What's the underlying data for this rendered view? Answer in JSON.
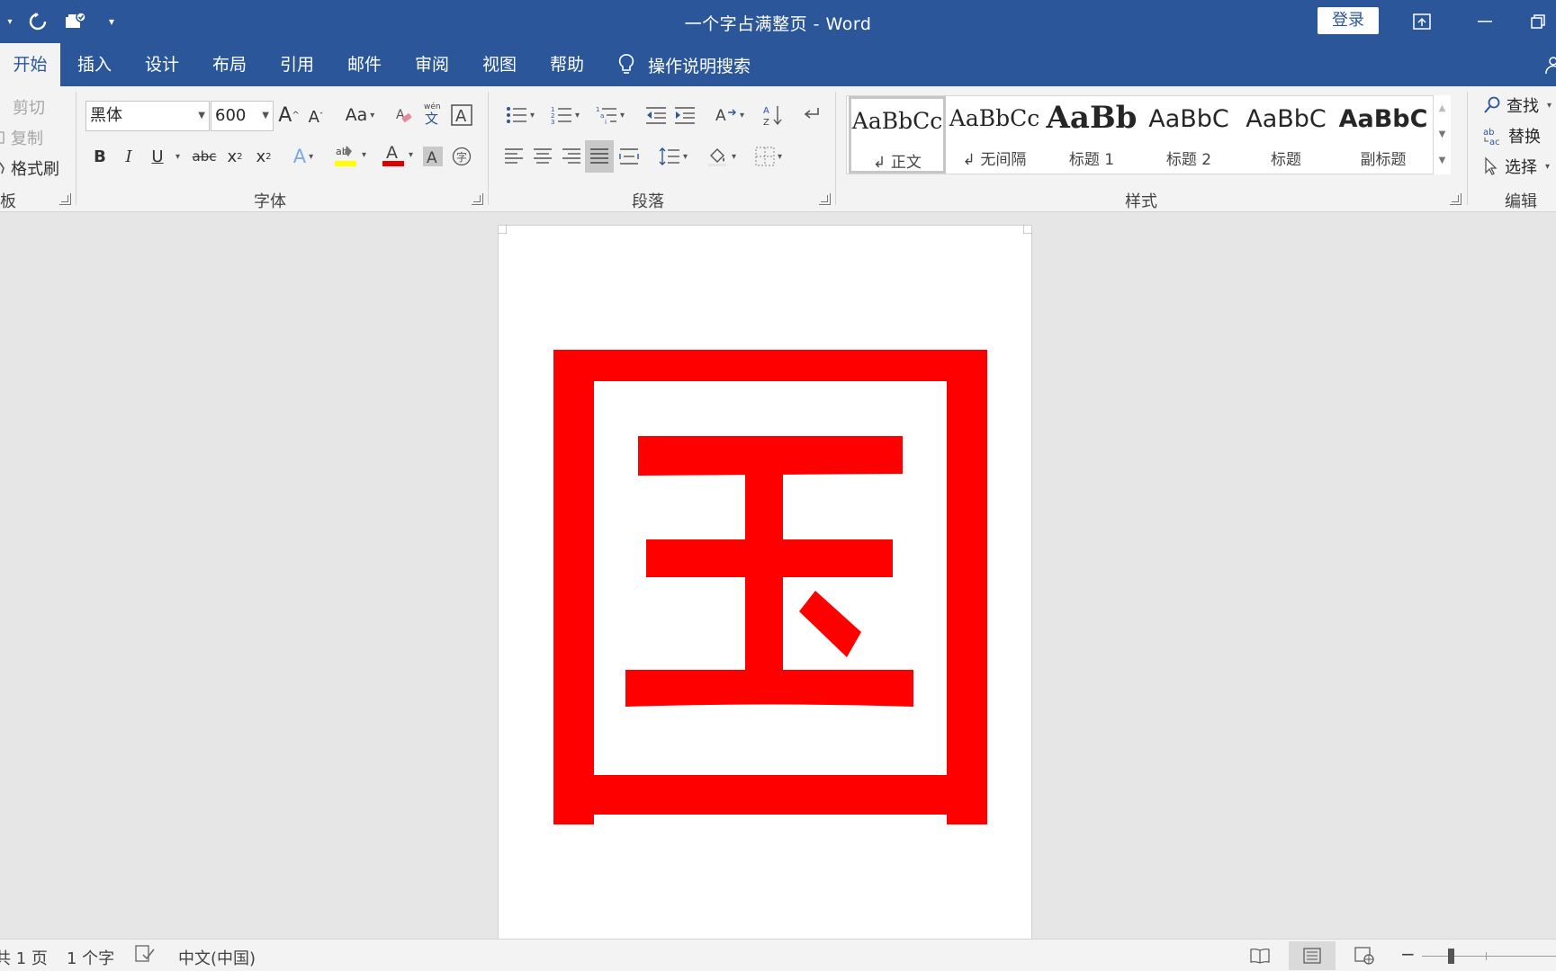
{
  "titlebar": {
    "title": "一个字占满整页 - Word",
    "login_label": "登录"
  },
  "tabs": [
    {
      "label": "开始",
      "active": true
    },
    {
      "label": "插入"
    },
    {
      "label": "设计"
    },
    {
      "label": "布局"
    },
    {
      "label": "引用"
    },
    {
      "label": "邮件"
    },
    {
      "label": "审阅"
    },
    {
      "label": "视图"
    },
    {
      "label": "帮助"
    }
  ],
  "tell_me": {
    "label": "操作说明搜索",
    "icon": "lightbulb-icon"
  },
  "clipboard": {
    "cut_label": "剪切",
    "copy_label": "复制",
    "format_painter_label": "格式刷",
    "group_label": "板"
  },
  "font": {
    "font_name": "黑体",
    "font_size": "600",
    "group_label": "字体",
    "highlight_color": "#ffff00",
    "font_color": "#e00000"
  },
  "paragraph": {
    "group_label": "段落"
  },
  "styles": {
    "group_label": "样式",
    "items": [
      {
        "sample": "AaBbCc",
        "name": "正文",
        "selected": true
      },
      {
        "sample": "AaBbCc",
        "name": "无间隔"
      },
      {
        "sample": "AaBb",
        "name": "标题 1"
      },
      {
        "sample": "AaBbC",
        "name": "标题 2"
      },
      {
        "sample": "AaBbC",
        "name": "标题"
      },
      {
        "sample": "AaBbC",
        "name": "副标题"
      }
    ]
  },
  "editing": {
    "find_label": "查找",
    "replace_label": "替换",
    "select_label": "选择",
    "group_label": "编辑"
  },
  "document": {
    "character": "国",
    "character_color": "#ff0000"
  },
  "statusbar": {
    "page_info": "共 1 页",
    "word_count": "1 个字",
    "language": "中文(中国)",
    "zoom_minus": "−"
  },
  "colors": {
    "title_bar": "#2b579a",
    "ribbon": "#f3f3f3",
    "canvas": "#e6e6e6"
  }
}
